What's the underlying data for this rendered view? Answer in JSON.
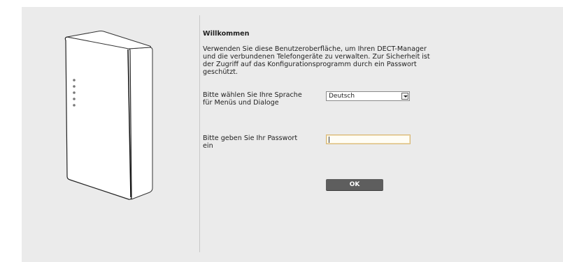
{
  "welcome": {
    "title": "Willkommen",
    "intro_lines": [
      "Verwenden Sie diese Benutzeroberfläche, um Ihren DECT-Manager",
      "und die verbundenen Telefongeräte zu verwalten. Zur Sicherheit ist",
      "der Zugriff auf das Konfigurationsprogramm durch ein Passwort",
      "geschützt."
    ]
  },
  "language": {
    "label_lines": [
      "Bitte wählen Sie Ihre Sprache",
      "für Menüs und Dialoge"
    ],
    "selected": "Deutsch"
  },
  "password": {
    "label_lines": [
      "Bitte geben Sie Ihr Passwort",
      "ein"
    ],
    "value": ""
  },
  "ok_button": {
    "label": "OK"
  },
  "colors": {
    "panel_bg": "#ebebeb",
    "button_bg": "#5e5e5e",
    "field_focus_border": "#d9b877"
  }
}
